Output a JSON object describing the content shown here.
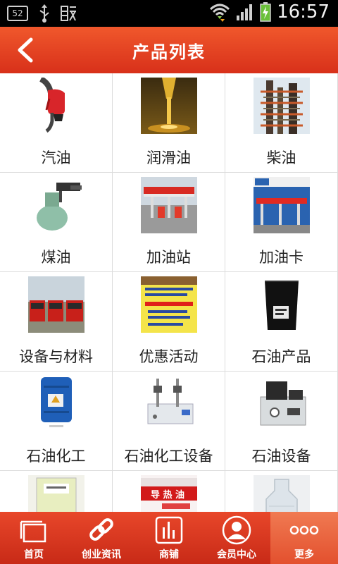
{
  "status_bar": {
    "notification_count": "52",
    "time": "16:57"
  },
  "header": {
    "title": "产品列表"
  },
  "products": [
    {
      "label": "汽油",
      "icon": "fuel-nozzle"
    },
    {
      "label": "润滑油",
      "icon": "lubricant-pour"
    },
    {
      "label": "柴油",
      "icon": "refinery-tower"
    },
    {
      "label": "煤油",
      "icon": "kerosene-torch"
    },
    {
      "label": "加油站",
      "icon": "gas-station"
    },
    {
      "label": "加油卡",
      "icon": "fuel-card-station"
    },
    {
      "label": "设备与材料",
      "icon": "fire-trucks"
    },
    {
      "label": "优惠活动",
      "icon": "promotion-poster"
    },
    {
      "label": "石油产品",
      "icon": "oil-beaker"
    },
    {
      "label": "石油化工",
      "icon": "chemical-drum"
    },
    {
      "label": "石油化工设备",
      "icon": "lab-apparatus"
    },
    {
      "label": "石油设备",
      "icon": "test-machine"
    },
    {
      "label": "",
      "icon": "sample-bottle"
    },
    {
      "label": "",
      "icon": "heat-oil-drum"
    },
    {
      "label": "",
      "icon": "glass-bottle"
    }
  ],
  "tabbar": [
    {
      "label": "首页",
      "icon": "home-window"
    },
    {
      "label": "创业资讯",
      "icon": "chain-link"
    },
    {
      "label": "商铺",
      "icon": "bar-chart"
    },
    {
      "label": "会员中心",
      "icon": "user"
    },
    {
      "label": "更多",
      "icon": "more-dots",
      "active": true
    }
  ],
  "colors": {
    "header_top": "#f0582c",
    "header_bottom": "#d8301a",
    "tabbar": "#d8371f",
    "tab_active": "#eb6540"
  }
}
